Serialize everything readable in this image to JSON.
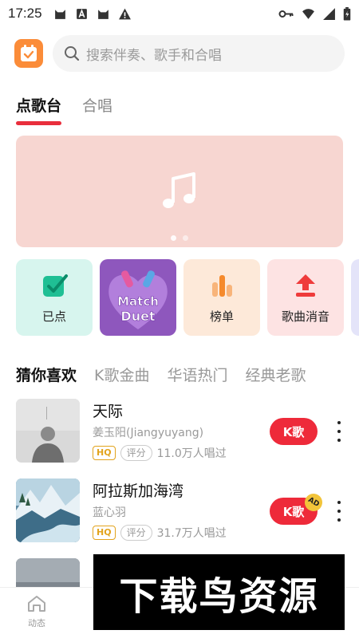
{
  "status_bar": {
    "time": "17:25"
  },
  "search": {
    "placeholder": "搜索伴奏、歌手和合唱"
  },
  "tabs": [
    {
      "label": "点歌台",
      "active": true
    },
    {
      "label": "合唱",
      "active": false
    }
  ],
  "banner": {
    "icon": "music-note-icon",
    "page_count": 2,
    "current_page": 1
  },
  "shortcuts": [
    {
      "label": "已点",
      "icon": "check-box-icon",
      "bg": "#d7f5ee"
    },
    {
      "label": "Match Duet",
      "icon": "match-duet-logo",
      "bg": "#8e57bd"
    },
    {
      "label": "榜单",
      "icon": "bar-chart-icon",
      "bg": "#fde9d9"
    },
    {
      "label": "歌曲消音",
      "icon": "upload-icon",
      "bg": "#fde3e3"
    }
  ],
  "categories": [
    {
      "label": "猜你喜欢",
      "active": true
    },
    {
      "label": "K歌金曲",
      "active": false
    },
    {
      "label": "华语热门",
      "active": false
    },
    {
      "label": "经典老歌",
      "active": false
    }
  ],
  "songs": [
    {
      "title": "天际",
      "artist": "姜玉阳(Jiangyuyang)",
      "quality": "HQ",
      "rate_label": "评分",
      "listeners": "11.0万人唱过",
      "button": "K歌",
      "ad": ""
    },
    {
      "title": "阿拉斯加海湾",
      "artist": "蓝心羽",
      "quality": "HQ",
      "rate_label": "评分",
      "listeners": "31.7万人唱过",
      "button": "K歌",
      "ad": "AD"
    }
  ],
  "bottom_nav": {
    "home_label": "动态"
  },
  "watermark": "下载鸟资源",
  "colors": {
    "accent": "#e92e3c",
    "banner": "#f7d6d1",
    "logo": "#fb8c39"
  }
}
